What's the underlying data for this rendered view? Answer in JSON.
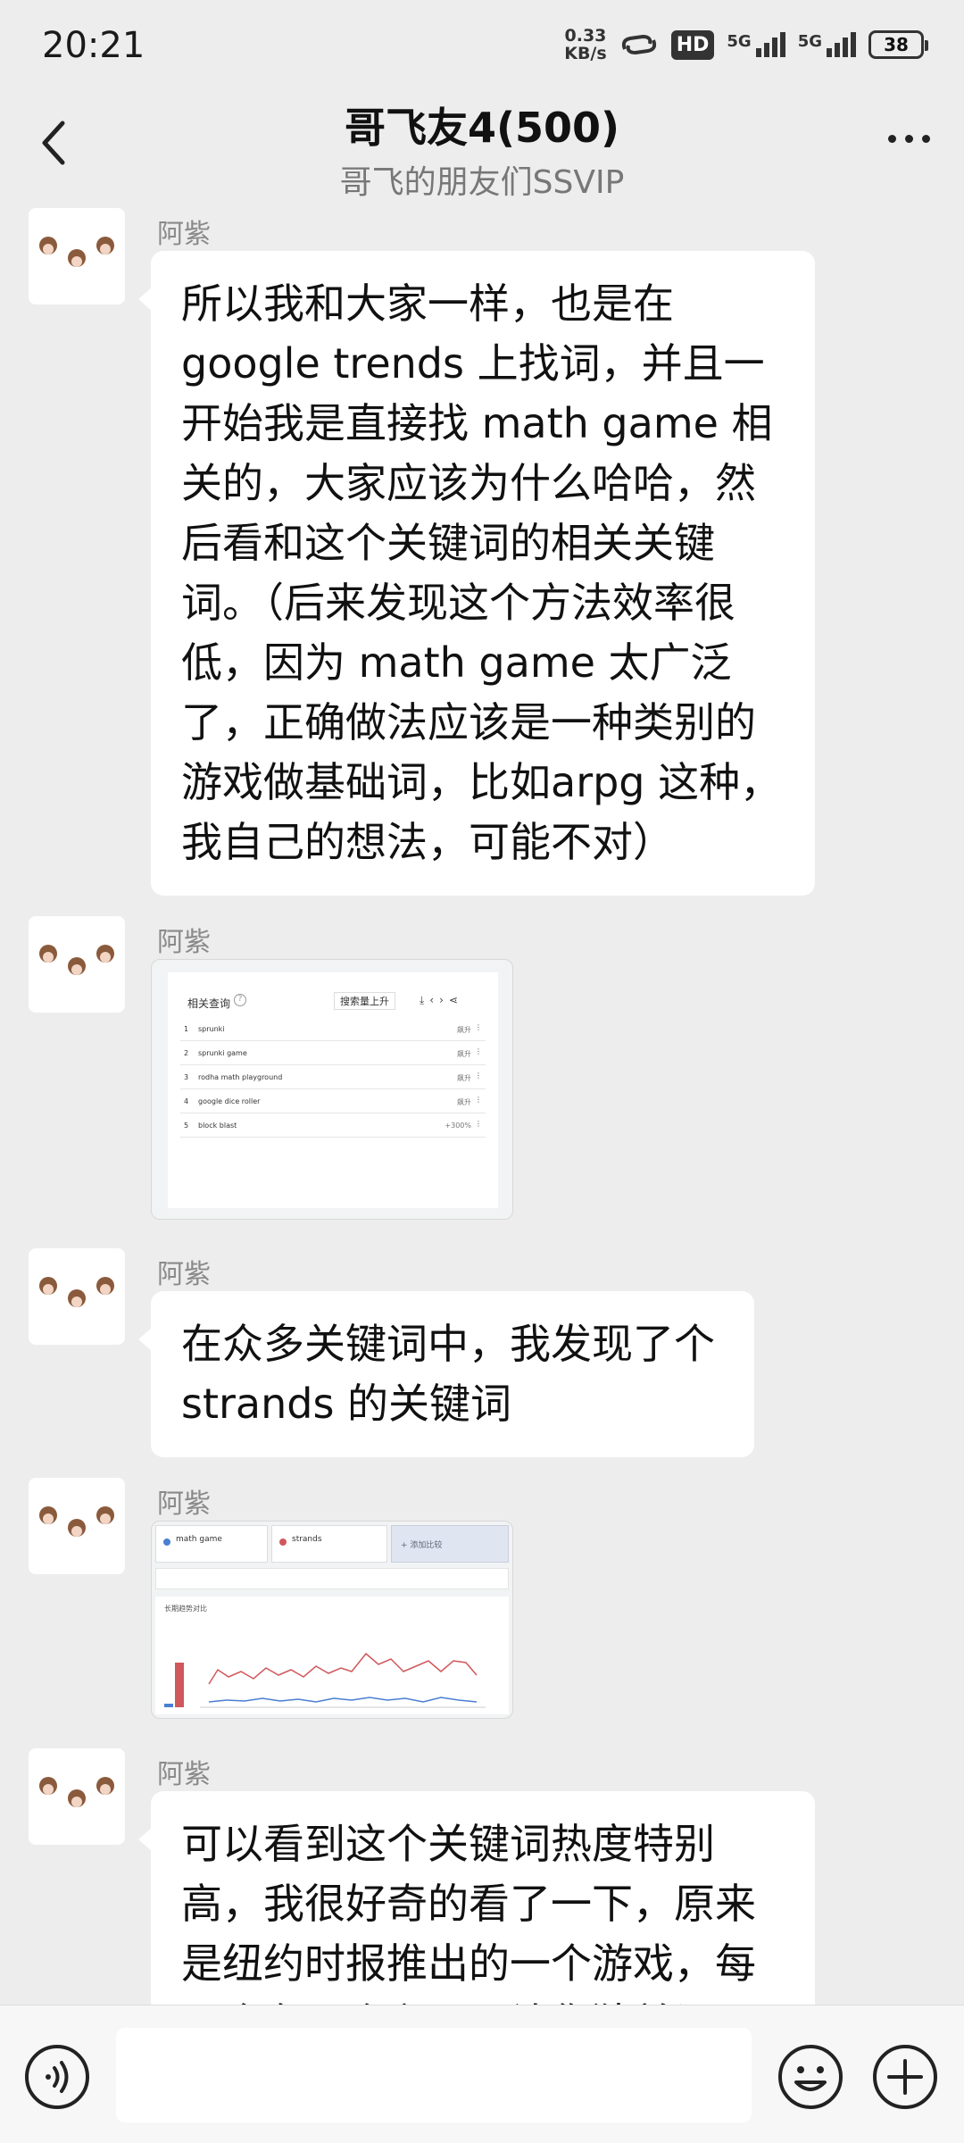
{
  "status_bar": {
    "time": "20:21",
    "net_speed_value": "0.33",
    "net_speed_unit": "KB/s",
    "hd_label": "HD",
    "signal1_label": "5G",
    "signal2_label": "5G",
    "battery": "38"
  },
  "header": {
    "title": "哥飞友4(500)",
    "subtitle": "哥飞的朋友们SSVIP"
  },
  "messages": [
    {
      "sender": "阿紫",
      "type": "text",
      "text": "所以我和大家一样，也是在google trends 上找词，并且一开始我是直接找 math game 相关的，大家应该为什么哈哈，然后看和这个关键词的相关关键词。（后来发现这个方法效率很低，因为 math game 太广泛了，正确做法应该是一种类别的游戏做基础词，比如arpg 这种，我自己的想法，可能不对）"
    },
    {
      "sender": "阿紫",
      "type": "image",
      "image": {
        "header": "相关查询",
        "dropdown": "搜索量上升",
        "rows": [
          {
            "rank": "1",
            "query": "sprunki",
            "value": "飙升"
          },
          {
            "rank": "2",
            "query": "sprunki game",
            "value": "飙升"
          },
          {
            "rank": "3",
            "query": "rodha math playground",
            "value": "飙升"
          },
          {
            "rank": "4",
            "query": "google dice roller",
            "value": "飙升"
          },
          {
            "rank": "5",
            "query": "block blast",
            "value": "+300%"
          }
        ]
      }
    },
    {
      "sender": "阿紫",
      "type": "text",
      "text": "在众多关键词中，我发现了个strands 的关键词"
    },
    {
      "sender": "阿紫",
      "type": "image",
      "image": {
        "term1": "math game",
        "term2": "strands",
        "add_label": "+ 添加比较",
        "chart_label": "长期趋势对比"
      }
    },
    {
      "sender": "阿紫",
      "type": "text",
      "text": "可以看到这个关键词热度特别高，我很好奇的看了一下，原来是纽约时报推出的一个游戏，每天会有一个主题，让你猜单词"
    }
  ],
  "colors": {
    "background": "#ededed",
    "bubble": "#ffffff",
    "series1": "#4a7fd1",
    "series2": "#d0575b"
  }
}
